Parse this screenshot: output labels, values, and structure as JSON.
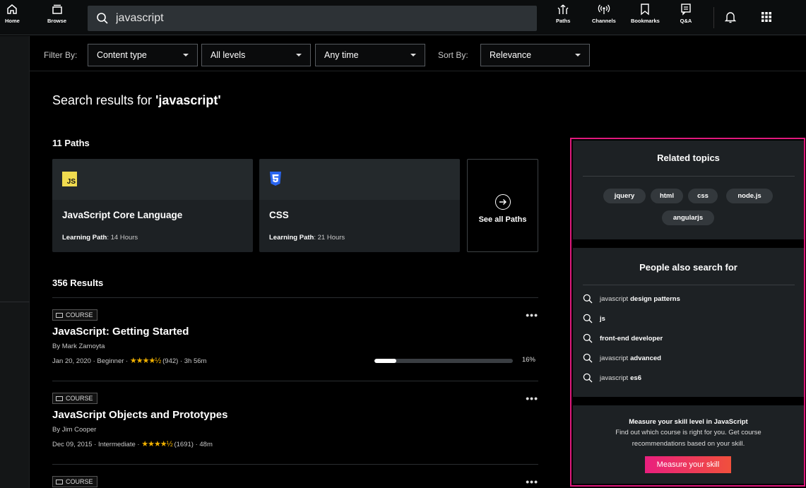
{
  "nav": {
    "home": "Home",
    "browse": "Browse",
    "paths": "Paths",
    "channels": "Channels",
    "bookmarks": "Bookmarks",
    "qa": "Q&A"
  },
  "search": {
    "value": "javascript"
  },
  "filters": {
    "filter_by_label": "Filter By:",
    "content_type": "Content type",
    "levels": "All levels",
    "time": "Any time",
    "sort_by_label": "Sort By:",
    "sort": "Relevance"
  },
  "main": {
    "title_prefix": "Search results for ",
    "title_query": "'javascript'",
    "paths_heading": "11 Paths",
    "paths": [
      {
        "title": "JavaScript Core Language",
        "meta_label": "Learning Path",
        "meta_value": ": 14 Hours",
        "logo": "JS"
      },
      {
        "title": "CSS",
        "meta_label": "Learning Path",
        "meta_value": ": 21 Hours"
      }
    ],
    "see_all": "See all Paths",
    "results_heading": "356 Results",
    "results": [
      {
        "badge": "COURSE",
        "title": "JavaScript: Getting Started",
        "author": "By Mark Zamoyta",
        "meta_prefix": "Jan 20, 2020 · Beginner · ",
        "stars": "★★★★½",
        "meta_suffix": " (942) · 3h 56m",
        "progress": 16,
        "progress_label": "16%"
      },
      {
        "badge": "COURSE",
        "title": "JavaScript Objects and Prototypes",
        "author": "By Jim Cooper",
        "meta_prefix": "Dec 09, 2015 · Intermediate · ",
        "stars": "★★★★½",
        "meta_suffix": " (1691) · 48m"
      },
      {
        "badge": "COURSE"
      }
    ],
    "more": "•••"
  },
  "related": {
    "title": "Related topics",
    "chips": [
      "jquery",
      "html",
      "css",
      "node.js",
      "angularjs"
    ]
  },
  "people": {
    "title": "People also search for",
    "items": [
      {
        "pre": "javascript",
        "bold": "design patterns"
      },
      {
        "pre": "",
        "bold": "js"
      },
      {
        "pre": "",
        "bold": "front-end developer"
      },
      {
        "pre": "javascript",
        "bold": "advanced"
      },
      {
        "pre": "javascript",
        "bold": "es6"
      }
    ]
  },
  "measure": {
    "title": "Measure your skill level in JavaScript",
    "desc": "Find out which course is right for you. Get course recommendations based on your skill.",
    "button": "Measure your skill"
  },
  "colors": {
    "accent": "#e0197d",
    "star": "#f1b100",
    "js_yellow": "#f0db4f",
    "css_blue": "#2965f1"
  }
}
